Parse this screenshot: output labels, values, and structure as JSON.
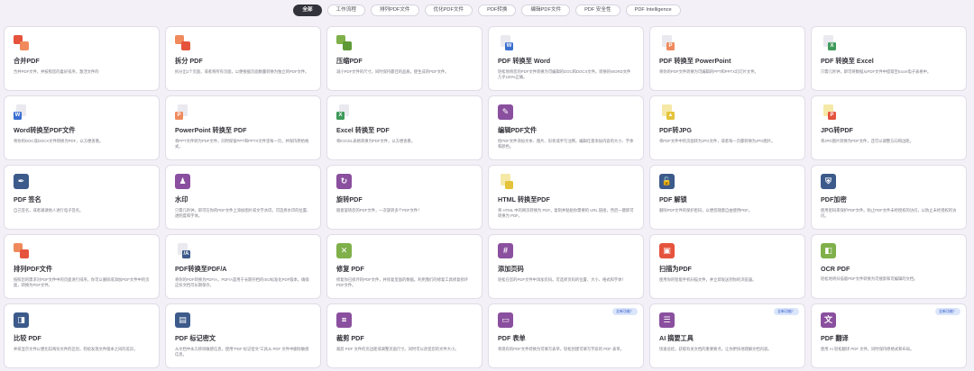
{
  "filters": [
    "全部",
    "工作流程",
    "排列PDF文件",
    "优化PDF文件",
    "PDF转换",
    "编辑PDF文件",
    "PDF 安全性",
    "PDF Intelligence"
  ],
  "tools": [
    {
      "title": "合并PDF",
      "desc": "合并PDF文件，并按照您的喜好排序，激活文件的",
      "icon": "merge-icon"
    },
    {
      "title": "拆分 PDF",
      "desc": "拆分出1个页面，或者将所有页面，以便根据页面数量转换为独立的PDF文件。",
      "icon": "split-icon"
    },
    {
      "title": "压缩PDF",
      "desc": "减小PDF文件的尺寸，同时保持最佳的品质。使生成的PDF文件。",
      "icon": "compress-icon"
    },
    {
      "title": "PDF 转换至 Word",
      "desc": "轻松地将您的PDF文件转换为可编辑的DOC和DOCX文件。转换的WORD文件几乎100%正确。",
      "icon": "word-icon"
    },
    {
      "title": "PDF 转换至 PowerPoint",
      "desc": "将你的PDF文件转换为可编辑的PPT和PPTX幻灯片文件。",
      "icon": "powerpoint-icon"
    },
    {
      "title": "PDF 转换至 Excel",
      "desc": "只需几秒钟，即可将数据从PDF文件中提取至Excel电子表格中。",
      "icon": "excel-icon"
    },
    {
      "title": "Word转换至PDF文件",
      "desc": "将你的DOC或DOCX文件转换为PDF，以方便查看。",
      "icon": "word-to-pdf-icon"
    },
    {
      "title": "PowerPoint 转换至 PDF",
      "desc": "将PPT文件转为PDF文件，同时保留PPT和PPTX文件里每一页，并保持原始格式。",
      "icon": "ppt-to-pdf-icon"
    },
    {
      "title": "Excel 转换至 PDF",
      "desc": "将EXCEL表格转换为PDF文件，以方便查看。",
      "icon": "excel-to-pdf-icon"
    },
    {
      "title": "编辑PDF文件",
      "desc": "给PDF文件添加文本、图片、形状或手写注释。编辑任意添加内容的大小、字体和颜色。",
      "icon": "edit-icon"
    },
    {
      "title": "PDF转JPG",
      "desc": "将PDF文件中的页面转为JPG文件，或者每一页都转换为JPG图片。",
      "icon": "pdf-to-jpg-icon"
    },
    {
      "title": "JPG转PDF",
      "desc": "将JPG图片转换为PDF文件，还可以调整方向和边距。",
      "icon": "jpg-to-pdf-icon"
    },
    {
      "title": "PDF 签名",
      "desc": "自己签名，或者邀请他人进行电子签名。",
      "icon": "sign-icon"
    },
    {
      "title": "水印",
      "desc": "只需几秒钟，即可在你的PDF文件上添加图片或文字水印。可选择水印的位置、透明度和字体。",
      "icon": "watermark-icon"
    },
    {
      "title": "旋转PDF",
      "desc": "随意旋转您的PDF文件，一次旋转多个PDF文件！",
      "icon": "rotate-icon"
    },
    {
      "title": "HTML 转换至PDF",
      "desc": "将 HTML 中的网页转换为 PDF。复制并粘贴你需要的 URL 链接，然后一键即可转换为 PDF。",
      "icon": "html-icon"
    },
    {
      "title": "PDF 解锁",
      "desc": "删除PDF文件的保护密码，以便您随意自由使用PDF。",
      "icon": "unlock-icon"
    },
    {
      "title": "PDF加密",
      "desc": "使用密码来保护PDF文件。防止PDF文件未经授权的访问，以防止未经授权的访问。",
      "icon": "protect-icon"
    },
    {
      "title": "排列PDF文件",
      "desc": "按照您的需求对PDF文件中的页面进行排序。你可以删除或添加PDF文件中的页面，转换为PDF文件。",
      "icon": "organize-icon"
    },
    {
      "title": "PDF转换至PDF/A",
      "desc": "将你的PDF转换为PDF/A，PDF/A是用于长期存档的ISO标准化PDF版本。确保这份文档可长期保存。",
      "icon": "pdfa-icon"
    },
    {
      "title": "修复 PDF",
      "desc": "修复你已损坏的PDF文件，并恢复里面的数据。利用我们的修复工具修复损坏PDF文件。",
      "icon": "repair-icon"
    },
    {
      "title": "添加页码",
      "desc": "轻松在您的PDF文件中添加页码。可选择页码的位置、大小、格式和字体！",
      "icon": "page-numbers-icon"
    },
    {
      "title": "扫描为PDF",
      "desc": "使用你的智能手机扫描文件，并立即发送到你的浏览器。",
      "icon": "scan-icon"
    },
    {
      "title": "OCR PDF",
      "desc": "轻松地将扫描版PDF文件转换为可搜索和可编辑的文档。",
      "icon": "ocr-icon"
    },
    {
      "title": "比较 PDF",
      "desc": "并排显示文件以便比较两份文件的区别，轻松发现文件版本之间的差异。",
      "icon": "compare-icon"
    },
    {
      "title": "PDF 标记密文",
      "desc": "从文档中永久移除敏感信息，使用\"PDF 标记密文\"工具从 PDF 文件中删除敏感信息。",
      "icon": "redact-icon"
    },
    {
      "title": "裁剪 PDF",
      "desc": "裁剪 PDF 文件的页边距或调整页面尺寸。同时可以改变您的文件大小。",
      "icon": "crop-icon"
    },
    {
      "title": "PDF 表单",
      "desc": "将现有的PDF文件转换为可填写表单，轻松创建可填写字段的 PDF 表单。",
      "icon": "forms-icon",
      "badge": "全新功能！"
    },
    {
      "title": "AI 摘要工具",
      "desc": "快速总结，获取有关文档的重要要点，让你更快地理解文档内容。",
      "icon": "ai-summary-icon",
      "badge": "全新功能！"
    },
    {
      "title": "PDF 翻译",
      "desc": "使用 AI 轻松翻译 PDF 文件，同时保持原格式和布局。",
      "icon": "translate-icon",
      "badge": "全新功能！"
    }
  ],
  "colors": {
    "red": "#e5533d",
    "orange": "#f08a5d",
    "green": "#7fb04a",
    "blue": "#3a6fd0",
    "purple": "#8a4f9e",
    "yellow": "#e4c33a",
    "navy": "#3c5a8a",
    "teal": "#4a8a6a"
  }
}
